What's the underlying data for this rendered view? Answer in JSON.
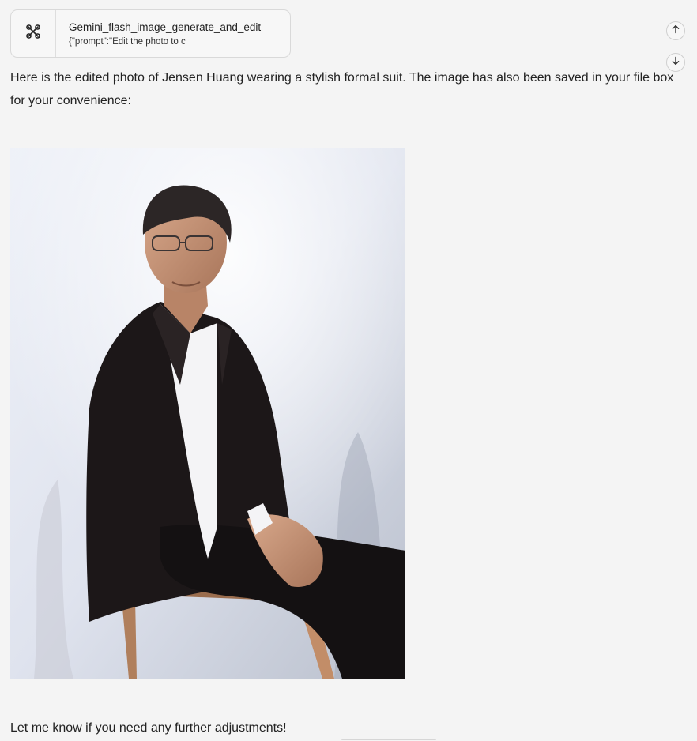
{
  "tool_call": {
    "icon": "tool-link-icon",
    "name": "Gemini_flash_image_generate_and_edit",
    "args_preview": "{\"prompt\":\"Edit the photo to c"
  },
  "nav": {
    "up_icon": "arrow-up-icon",
    "down_icon": "arrow-down-icon"
  },
  "message": {
    "intro": "Here is the edited photo of Jensen Huang wearing a stylish formal suit. The image has also been saved in your file box for your convenience:",
    "closing": "Let me know if you need any further adjustments!"
  },
  "colors": {
    "page_background": "#f4f4f4",
    "card_border": "#d9d9d9",
    "text": "#222222"
  }
}
